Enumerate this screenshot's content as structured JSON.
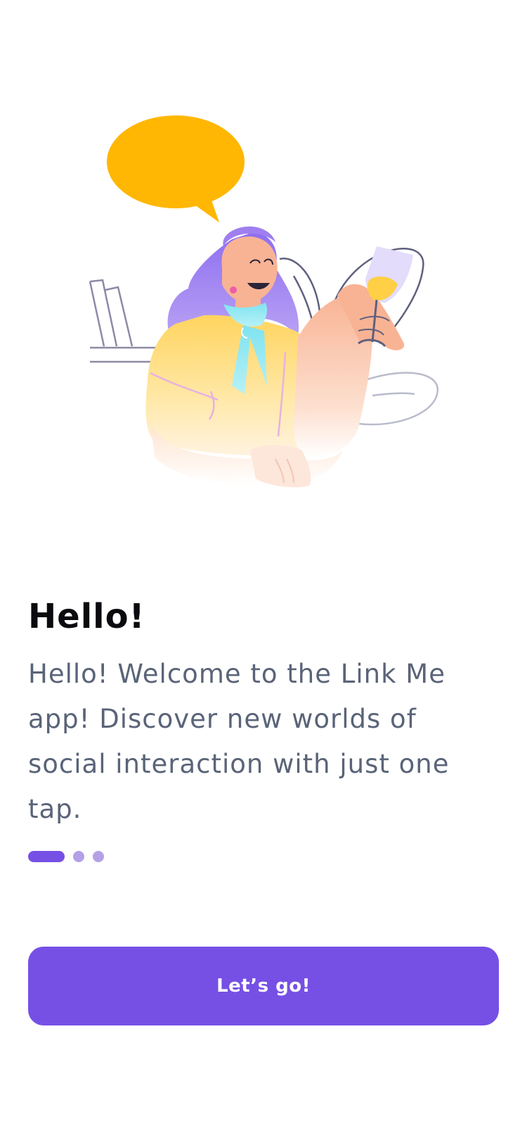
{
  "illustration": {
    "semantic": "woman-with-glass-and-speech-bubble",
    "colors": {
      "bubble": "#ffb703",
      "hair": "#9f7ff0",
      "skin": "#f8b394",
      "shirt": "#ffd867",
      "scarf": "#7fe3f0",
      "glass": "#e3dcfb",
      "drink": "#ffcf45",
      "line": "#5e607d"
    }
  },
  "onboarding": {
    "title": "Hello!",
    "description": "Hello! Welcome to the Link Me app! Discover new worlds of social interaction with just one tap.",
    "pager": {
      "total": 3,
      "active_index": 0
    }
  },
  "actions": {
    "primary_label": "Let’s go!"
  },
  "theme": {
    "accent": "#7650e5",
    "accent_light": "#b4a0e6",
    "text_primary": "#0b0b0f",
    "text_secondary": "#5a6478",
    "background": "#ffffff"
  }
}
